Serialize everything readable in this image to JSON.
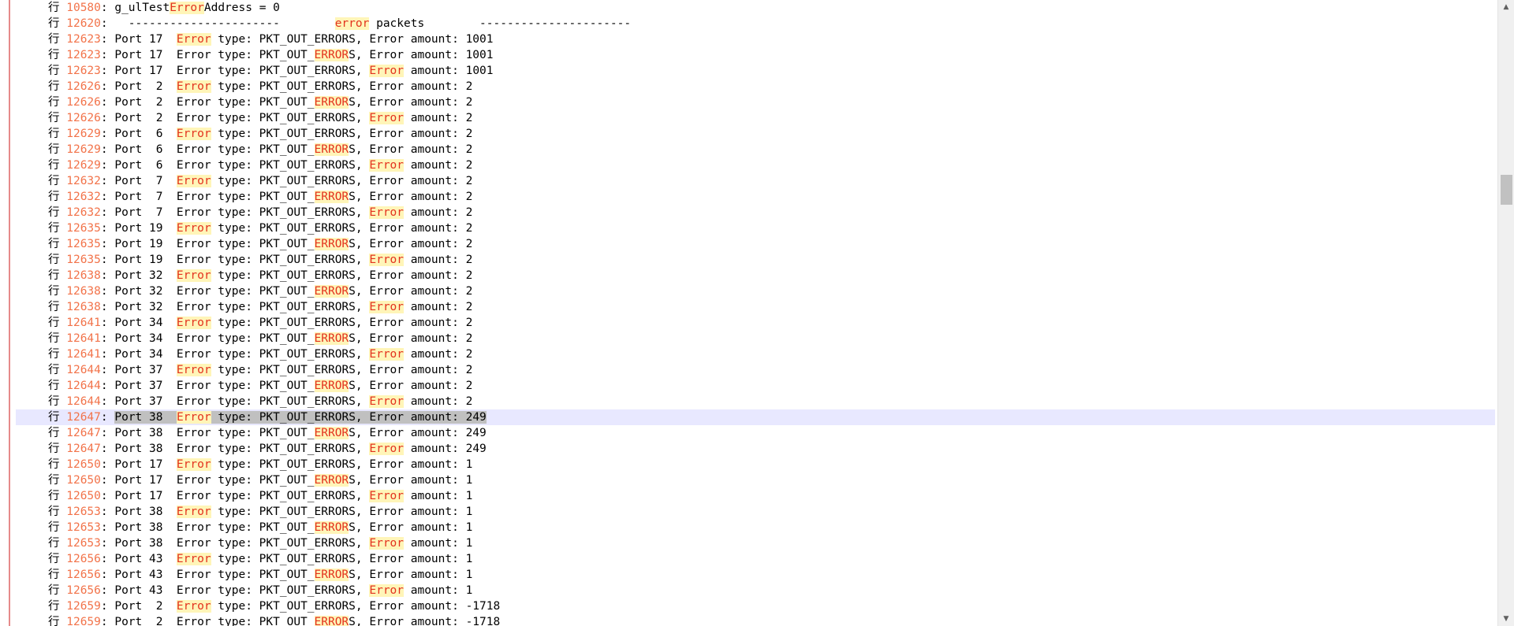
{
  "prefix": "行",
  "highlight_color": "#fff5b8",
  "highlight_text_color": "#e3321e",
  "line_number_color": "#f2734a",
  "current_row_color": "#e8e8ff",
  "lines": [
    {
      "num": "10580",
      "segs": [
        {
          "t": ": g_ulTest"
        },
        {
          "t": "Error",
          "h": true
        },
        {
          "t": "Address = 0"
        }
      ]
    },
    {
      "num": "12620",
      "segs": [
        {
          "t": ":   ----------------------        "
        },
        {
          "t": "error",
          "h": true
        },
        {
          "t": " packets        ----------------------"
        }
      ]
    },
    {
      "num": "12623",
      "segs": [
        {
          "t": ": Port 17  "
        },
        {
          "t": "Error",
          "h": true
        },
        {
          "t": " type: PKT_OUT_ERRORS, Error amount: 1001"
        }
      ]
    },
    {
      "num": "12623",
      "segs": [
        {
          "t": ": Port 17  Error type: PKT_OUT_"
        },
        {
          "t": "ERROR",
          "h": true
        },
        {
          "t": "S, Error amount: 1001"
        }
      ]
    },
    {
      "num": "12623",
      "segs": [
        {
          "t": ": Port 17  Error type: PKT_OUT_ERRORS, "
        },
        {
          "t": "Error",
          "h": true
        },
        {
          "t": " amount: 1001"
        }
      ]
    },
    {
      "num": "12626",
      "segs": [
        {
          "t": ": Port  2  "
        },
        {
          "t": "Error",
          "h": true
        },
        {
          "t": " type: PKT_OUT_ERRORS, Error amount: 2"
        }
      ]
    },
    {
      "num": "12626",
      "segs": [
        {
          "t": ": Port  2  Error type: PKT_OUT_"
        },
        {
          "t": "ERROR",
          "h": true
        },
        {
          "t": "S, Error amount: 2"
        }
      ]
    },
    {
      "num": "12626",
      "segs": [
        {
          "t": ": Port  2  Error type: PKT_OUT_ERRORS, "
        },
        {
          "t": "Error",
          "h": true
        },
        {
          "t": " amount: 2"
        }
      ]
    },
    {
      "num": "12629",
      "segs": [
        {
          "t": ": Port  6  "
        },
        {
          "t": "Error",
          "h": true
        },
        {
          "t": " type: PKT_OUT_ERRORS, Error amount: 2"
        }
      ]
    },
    {
      "num": "12629",
      "segs": [
        {
          "t": ": Port  6  Error type: PKT_OUT_"
        },
        {
          "t": "ERROR",
          "h": true
        },
        {
          "t": "S, Error amount: 2"
        }
      ]
    },
    {
      "num": "12629",
      "segs": [
        {
          "t": ": Port  6  Error type: PKT_OUT_ERRORS, "
        },
        {
          "t": "Error",
          "h": true
        },
        {
          "t": " amount: 2"
        }
      ]
    },
    {
      "num": "12632",
      "segs": [
        {
          "t": ": Port  7  "
        },
        {
          "t": "Error",
          "h": true
        },
        {
          "t": " type: PKT_OUT_ERRORS, Error amount: 2"
        }
      ]
    },
    {
      "num": "12632",
      "segs": [
        {
          "t": ": Port  7  Error type: PKT_OUT_"
        },
        {
          "t": "ERROR",
          "h": true
        },
        {
          "t": "S, Error amount: 2"
        }
      ]
    },
    {
      "num": "12632",
      "segs": [
        {
          "t": ": Port  7  Error type: PKT_OUT_ERRORS, "
        },
        {
          "t": "Error",
          "h": true
        },
        {
          "t": " amount: 2"
        }
      ]
    },
    {
      "num": "12635",
      "segs": [
        {
          "t": ": Port 19  "
        },
        {
          "t": "Error",
          "h": true
        },
        {
          "t": " type: PKT_OUT_ERRORS, Error amount: 2"
        }
      ]
    },
    {
      "num": "12635",
      "segs": [
        {
          "t": ": Port 19  Error type: PKT_OUT_"
        },
        {
          "t": "ERROR",
          "h": true
        },
        {
          "t": "S, Error amount: 2"
        }
      ]
    },
    {
      "num": "12635",
      "segs": [
        {
          "t": ": Port 19  Error type: PKT_OUT_ERRORS, "
        },
        {
          "t": "Error",
          "h": true
        },
        {
          "t": " amount: 2"
        }
      ]
    },
    {
      "num": "12638",
      "segs": [
        {
          "t": ": Port 32  "
        },
        {
          "t": "Error",
          "h": true
        },
        {
          "t": " type: PKT_OUT_ERRORS, Error amount: 2"
        }
      ]
    },
    {
      "num": "12638",
      "segs": [
        {
          "t": ": Port 32  Error type: PKT_OUT_"
        },
        {
          "t": "ERROR",
          "h": true
        },
        {
          "t": "S, Error amount: 2"
        }
      ]
    },
    {
      "num": "12638",
      "segs": [
        {
          "t": ": Port 32  Error type: PKT_OUT_ERRORS, "
        },
        {
          "t": "Error",
          "h": true
        },
        {
          "t": " amount: 2"
        }
      ]
    },
    {
      "num": "12641",
      "segs": [
        {
          "t": ": Port 34  "
        },
        {
          "t": "Error",
          "h": true
        },
        {
          "t": " type: PKT_OUT_ERRORS, Error amount: 2"
        }
      ]
    },
    {
      "num": "12641",
      "segs": [
        {
          "t": ": Port 34  Error type: PKT_OUT_"
        },
        {
          "t": "ERROR",
          "h": true
        },
        {
          "t": "S, Error amount: 2"
        }
      ]
    },
    {
      "num": "12641",
      "segs": [
        {
          "t": ": Port 34  Error type: PKT_OUT_ERRORS, "
        },
        {
          "t": "Error",
          "h": true
        },
        {
          "t": " amount: 2"
        }
      ]
    },
    {
      "num": "12644",
      "segs": [
        {
          "t": ": Port 37  "
        },
        {
          "t": "Error",
          "h": true
        },
        {
          "t": " type: PKT_OUT_ERRORS, Error amount: 2"
        }
      ]
    },
    {
      "num": "12644",
      "segs": [
        {
          "t": ": Port 37  Error type: PKT_OUT_"
        },
        {
          "t": "ERROR",
          "h": true
        },
        {
          "t": "S, Error amount: 2"
        }
      ]
    },
    {
      "num": "12644",
      "segs": [
        {
          "t": ": Port 37  Error type: PKT_OUT_ERRORS, "
        },
        {
          "t": "Error",
          "h": true
        },
        {
          "t": " amount: 2"
        }
      ]
    },
    {
      "num": "12647",
      "current": true,
      "segs": [
        {
          "t": ": "
        },
        {
          "t": "Port 38  ",
          "s": true
        },
        {
          "t": "Error",
          "h": true,
          "s": true
        },
        {
          "t": " type: PKT_OUT_ERRORS, Error amount: 249",
          "s": true
        }
      ]
    },
    {
      "num": "12647",
      "segs": [
        {
          "t": ": Port 38  Error type: PKT_OUT_"
        },
        {
          "t": "ERROR",
          "h": true
        },
        {
          "t": "S, Error amount: 249"
        }
      ]
    },
    {
      "num": "12647",
      "segs": [
        {
          "t": ": Port 38  Error type: PKT_OUT_ERRORS, "
        },
        {
          "t": "Error",
          "h": true
        },
        {
          "t": " amount: 249"
        }
      ]
    },
    {
      "num": "12650",
      "segs": [
        {
          "t": ": Port 17  "
        },
        {
          "t": "Error",
          "h": true
        },
        {
          "t": " type: PKT_OUT_ERRORS, Error amount: 1"
        }
      ]
    },
    {
      "num": "12650",
      "segs": [
        {
          "t": ": Port 17  Error type: PKT_OUT_"
        },
        {
          "t": "ERROR",
          "h": true
        },
        {
          "t": "S, Error amount: 1"
        }
      ]
    },
    {
      "num": "12650",
      "segs": [
        {
          "t": ": Port 17  Error type: PKT_OUT_ERRORS, "
        },
        {
          "t": "Error",
          "h": true
        },
        {
          "t": " amount: 1"
        }
      ]
    },
    {
      "num": "12653",
      "segs": [
        {
          "t": ": Port 38  "
        },
        {
          "t": "Error",
          "h": true
        },
        {
          "t": " type: PKT_OUT_ERRORS, Error amount: 1"
        }
      ]
    },
    {
      "num": "12653",
      "segs": [
        {
          "t": ": Port 38  Error type: PKT_OUT_"
        },
        {
          "t": "ERROR",
          "h": true
        },
        {
          "t": "S, Error amount: 1"
        }
      ]
    },
    {
      "num": "12653",
      "segs": [
        {
          "t": ": Port 38  Error type: PKT_OUT_ERRORS, "
        },
        {
          "t": "Error",
          "h": true
        },
        {
          "t": " amount: 1"
        }
      ]
    },
    {
      "num": "12656",
      "segs": [
        {
          "t": ": Port 43  "
        },
        {
          "t": "Error",
          "h": true
        },
        {
          "t": " type: PKT_OUT_ERRORS, Error amount: 1"
        }
      ]
    },
    {
      "num": "12656",
      "segs": [
        {
          "t": ": Port 43  Error type: PKT_OUT_"
        },
        {
          "t": "ERROR",
          "h": true
        },
        {
          "t": "S, Error amount: 1"
        }
      ]
    },
    {
      "num": "12656",
      "segs": [
        {
          "t": ": Port 43  Error type: PKT_OUT_ERRORS, "
        },
        {
          "t": "Error",
          "h": true
        },
        {
          "t": " amount: 1"
        }
      ]
    },
    {
      "num": "12659",
      "segs": [
        {
          "t": ": Port  2  "
        },
        {
          "t": "Error",
          "h": true
        },
        {
          "t": " type: PKT_OUT_ERRORS, Error amount: -1718"
        }
      ]
    },
    {
      "num": "12659",
      "segs": [
        {
          "t": ": Port  2  Error type: PKT_OUT_"
        },
        {
          "t": "ERROR",
          "h": true
        },
        {
          "t": "S, Error amount: -1718"
        }
      ]
    }
  ]
}
